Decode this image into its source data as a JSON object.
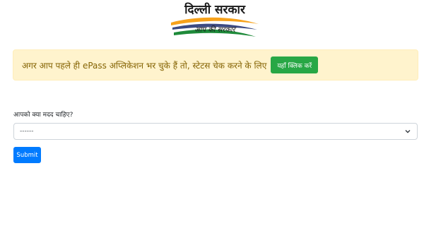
{
  "logo": {
    "title": "दिल्ली सरकार",
    "subtitle": "आप की सरकार",
    "colors": {
      "saffron": "#f7a21b",
      "green": "#1e8a3a",
      "navy": "#1a2a6c"
    }
  },
  "alert": {
    "message": "अगर आप पहले ही ePass अप्लिकेशन भर चुके हैं तो, स्टेटस चेक करने के लिए",
    "button_label": "यहाँ क्लिक करें"
  },
  "form": {
    "label": "आपको क्या मदद चाहिए?",
    "select_value": "------",
    "submit_label": "Submit"
  },
  "icons": {
    "select_chevron": "chevron-down-icon"
  }
}
